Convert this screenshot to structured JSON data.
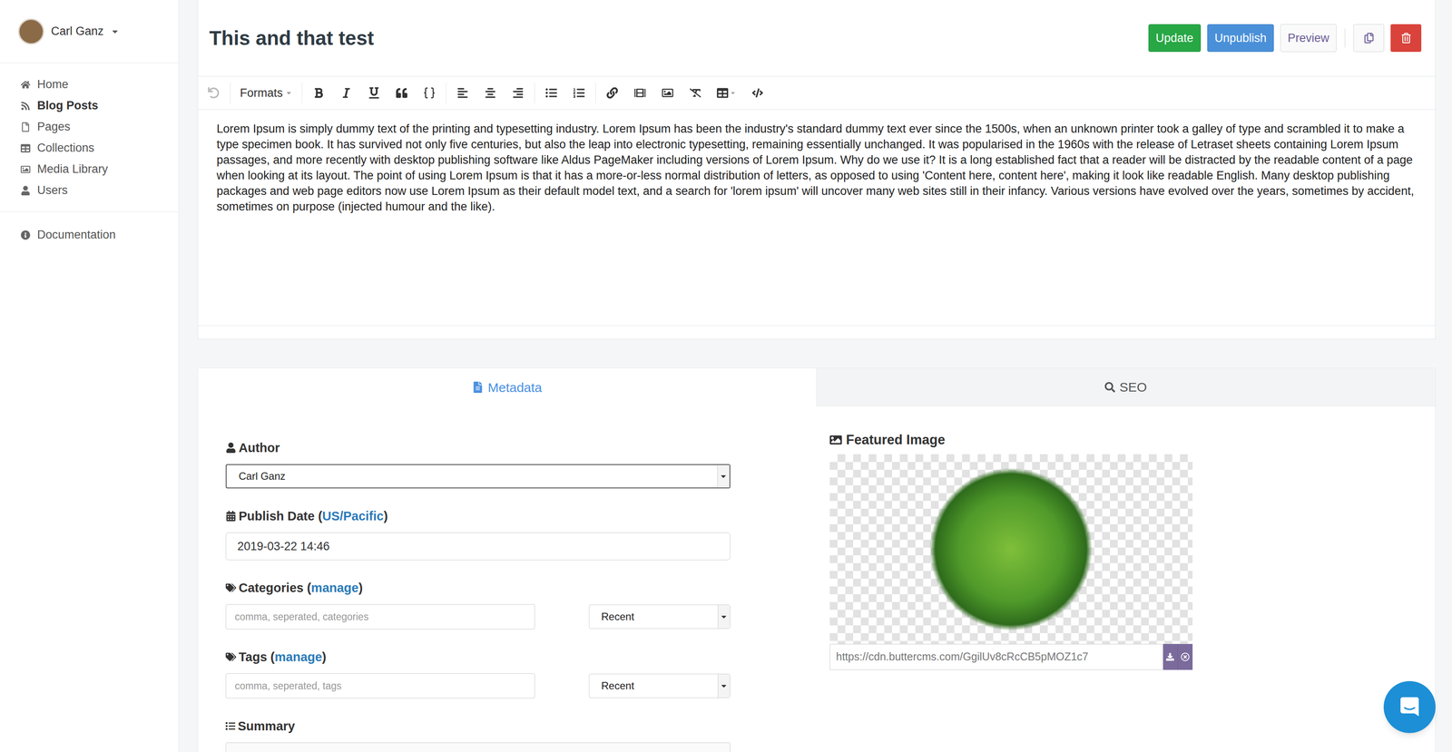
{
  "user": {
    "name": "Carl Ganz"
  },
  "sidebar": {
    "items": [
      {
        "label": "Home",
        "selected": false
      },
      {
        "label": "Blog Posts",
        "selected": true
      },
      {
        "label": "Pages",
        "selected": false
      },
      {
        "label": "Collections",
        "selected": false
      },
      {
        "label": "Media Library",
        "selected": false
      },
      {
        "label": "Users",
        "selected": false
      }
    ],
    "footer_items": [
      {
        "label": "Documentation",
        "selected": false
      }
    ]
  },
  "post": {
    "title": "This and that test",
    "body": "Lorem Ipsum is simply dummy text of the printing and typesetting industry. Lorem Ipsum has been the industry's standard dummy text ever since the 1500s, when an unknown printer took a galley of type and scrambled it to make a type specimen book. It has survived not only five centuries, but also the leap into electronic typesetting, remaining essentially unchanged. It was popularised in the 1960s with the release of Letraset sheets containing Lorem Ipsum passages, and more recently with desktop publishing software like Aldus PageMaker including versions of Lorem Ipsum. Why do we use it? It is a long established fact that a reader will be distracted by the readable content of a page when looking at its layout. The point of using Lorem Ipsum is that it has a more-or-less normal distribution of letters, as opposed to using 'Content here, content here', making it look like readable English. Many desktop publishing packages and web page editors now use Lorem Ipsum as their default model text, and a search for 'lorem ipsum' will uncover many web sites still in their infancy. Various versions have evolved over the years, sometimes by accident, sometimes on purpose (injected humour and the like)."
  },
  "actions": [
    "Update",
    "Unpublish",
    "Preview"
  ],
  "toolbar": {
    "formats": "Formats",
    "undo_disabled": true
  },
  "tabs": [
    {
      "label": "Metadata",
      "selected": true
    },
    {
      "label": "SEO",
      "selected": false
    }
  ],
  "fields": {
    "author": {
      "label": "Author",
      "value": "Carl Ganz"
    },
    "publish_date": {
      "label_before": "Publish Date (",
      "link": "US/Pacific",
      "label_after": ")",
      "value": "2019-03-22 14:46"
    },
    "categories": {
      "label_before": "Categories (",
      "link": "manage",
      "label_after": ")",
      "placeholder": "comma, seperated, categories",
      "sort": "Recent"
    },
    "tags": {
      "label_before": "Tags (",
      "link": "manage",
      "label_after": ")",
      "placeholder": "comma, seperated, tags",
      "sort": "Recent"
    },
    "summary": {
      "label": "Summary"
    }
  },
  "featured_image": {
    "label": "Featured Image",
    "url": "https://cdn.buttercms.com/GgilUv8cRcCB5pMOZ1c7"
  }
}
